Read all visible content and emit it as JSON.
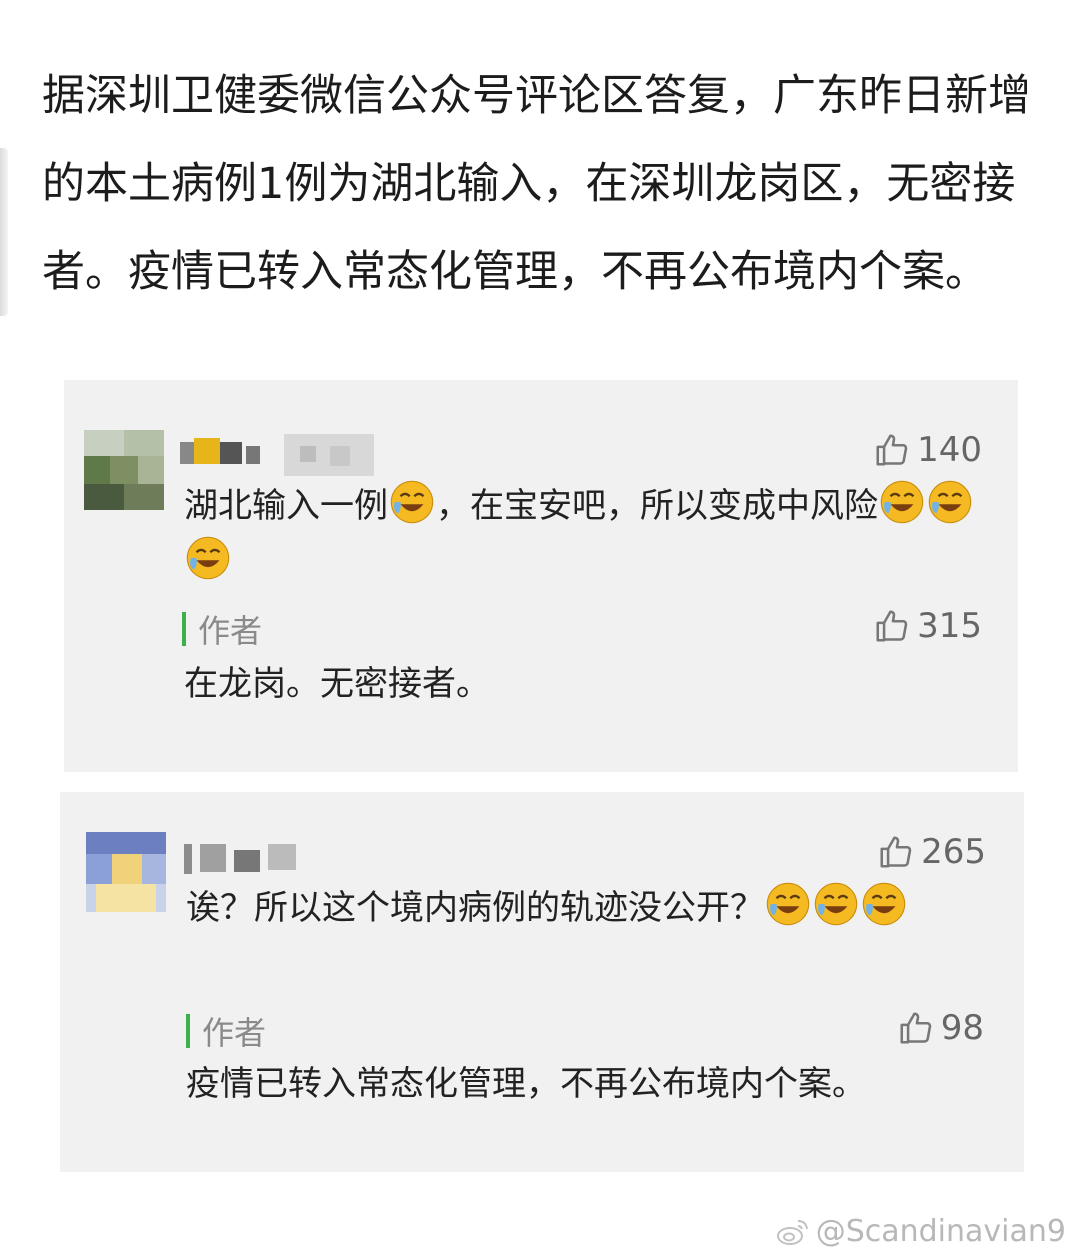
{
  "post": {
    "text": "据深圳卫健委微信公众号评论区答复，广东昨日新增的本土病例1例为湖北输入，在深圳龙岗区，无密接者。疫情已转入常态化管理，不再公布境内个案。"
  },
  "comments": [
    {
      "likes": "140",
      "text": "湖北输入一例",
      "text_after_emoji": "，在宝安吧，所以变成中风险",
      "reply": {
        "author_label": "作者",
        "likes": "315",
        "text": "在龙岗。无密接者。"
      }
    },
    {
      "likes": "265",
      "text": "诶？所以这个境内病例的轨迹没公开？",
      "reply": {
        "author_label": "作者",
        "likes": "98",
        "text": "疫情已转入常态化管理，不再公布境内个案。"
      }
    }
  ],
  "icons": {
    "like": "thumbs-up-icon",
    "emoji": "laugh-cry-emoji-icon",
    "weibo": "weibo-logo-icon"
  },
  "colors": {
    "card_bg": "#f1f1f1",
    "author_bar": "#3cb04a",
    "emoji_face": "#f5b922"
  },
  "watermark": {
    "text": "@Scandinavian9"
  }
}
